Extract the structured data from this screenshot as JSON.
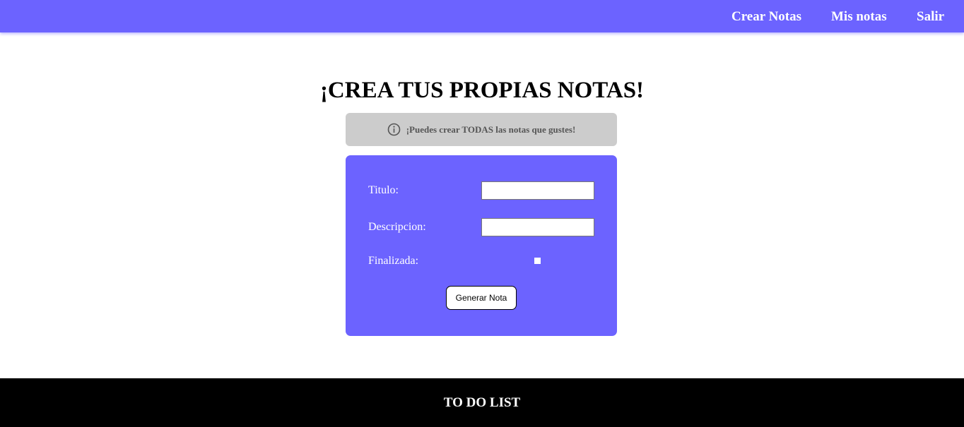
{
  "colors": {
    "primary": "#6c63ff",
    "info_bg": "#cccccc",
    "footer_bg": "#000000"
  },
  "nav": {
    "items": [
      {
        "label": "Crear Notas"
      },
      {
        "label": "Mis notas"
      },
      {
        "label": "Salir"
      }
    ]
  },
  "main": {
    "title": "¡CREA TUS PROPIAS NOTAS!",
    "info": {
      "icon": "info-icon",
      "text": "¡Puedes crear TODAS las notas que gustes!"
    },
    "form": {
      "titulo_label": "Titulo:",
      "titulo_value": "",
      "descripcion_label": "Descripcion:",
      "descripcion_value": "",
      "finalizada_label": "Finalizada:",
      "finalizada_checked": false,
      "submit_label": "Generar Nota"
    }
  },
  "footer": {
    "text": "TO DO LIST"
  }
}
